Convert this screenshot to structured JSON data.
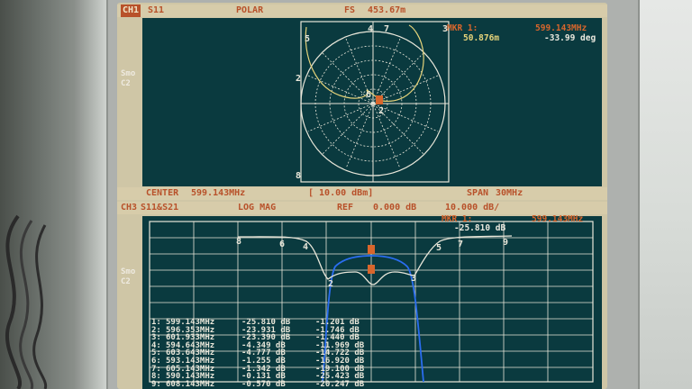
{
  "colors": {
    "screen_bg": "#0a3a3f",
    "trace_white": "#e9e7da",
    "trace_yellow": "#e5d37a",
    "trace_blue": "#2a6df0",
    "marker_orange": "#d8662c"
  },
  "ch1": {
    "channel_chip": "CH1",
    "param": "S11",
    "format": "POLAR",
    "fs_label": "FS",
    "fs_value": "453.67m",
    "side_label_1": "Smo",
    "side_label_2": "C2",
    "marker_label": "MKR 1:",
    "marker_freq": "599.143MHz",
    "marker_mag": "50.876m",
    "marker_phase": "-33.99 deg",
    "center_label": "CENTER",
    "center_value": "599.143MHz",
    "power": "[ 10.00 dBm]",
    "span_label": "SPAN",
    "span_value": "30MHz",
    "marker_ids": [
      "1",
      "2",
      "3",
      "4",
      "5",
      "6",
      "7",
      "8",
      "9"
    ]
  },
  "ch3": {
    "channel_chip": "CH3",
    "params": "S11&S21",
    "format": "LOG MAG",
    "ref_label": "REF",
    "ref_value": "0.000 dB",
    "scale": "10.000 dB/",
    "side_label_1": "Smo",
    "side_label_2": "C2",
    "marker_label": "MKR 1:",
    "marker_value": "-25.810 dB",
    "marker_freq": "599.143MHz",
    "table": [
      {
        "n": "1:",
        "f": "599.143MHz",
        "a": "-25.810 dB",
        "b": "-1.201 dB"
      },
      {
        "n": "2:",
        "f": "596.353MHz",
        "a": "-23.931 dB",
        "b": "-1.746 dB"
      },
      {
        "n": "3:",
        "f": "601.933MHz",
        "a": "-23.390 dB",
        "b": "-1.440 dB"
      },
      {
        "n": "4:",
        "f": "594.643MHz",
        "a": "-4.349 dB",
        "b": "-11.969 dB"
      },
      {
        "n": "5:",
        "f": "603.643MHz",
        "a": "-4.777 dB",
        "b": "-14.722 dB"
      },
      {
        "n": "6:",
        "f": "593.143MHz",
        "a": "-1.255 dB",
        "b": "-16.920 dB"
      },
      {
        "n": "7:",
        "f": "605.143MHz",
        "a": "-1.342 dB",
        "b": "-19.100 dB"
      },
      {
        "n": "8:",
        "f": "590.143MHz",
        "a": "-0.131 dB",
        "b": "-25.423 dB"
      },
      {
        "n": "9:",
        "f": "608.143MHz",
        "a": "-0.570 dB",
        "b": "-20.247 dB"
      }
    ]
  }
}
